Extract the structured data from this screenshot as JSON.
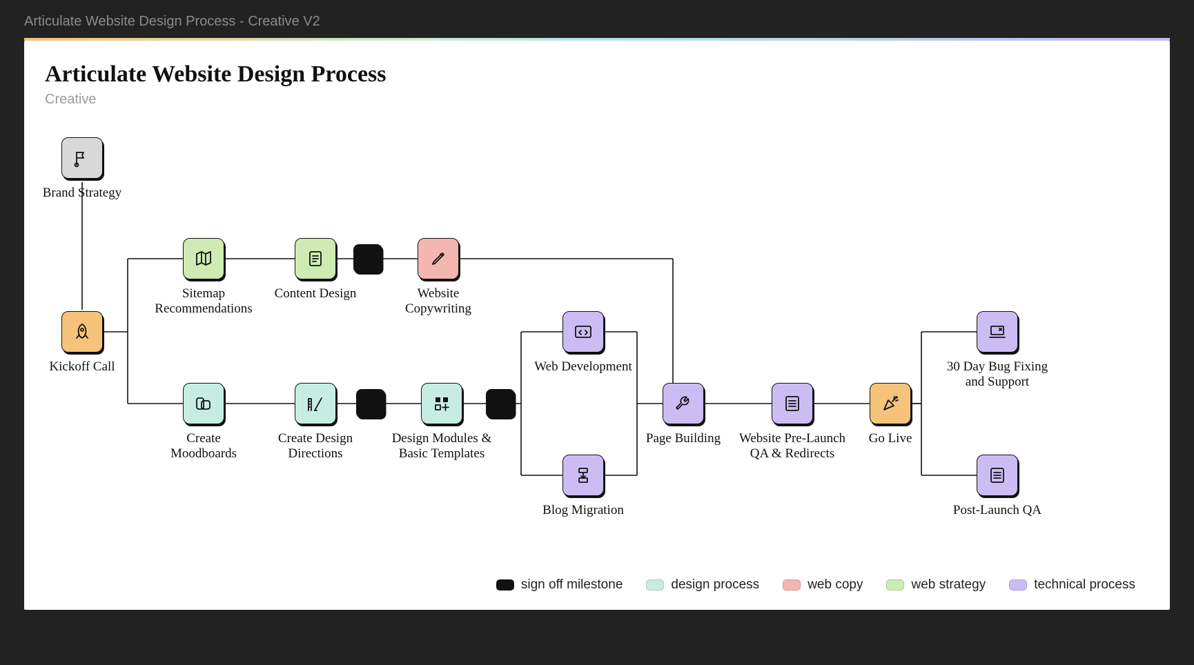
{
  "topbar": {
    "title": "Articulate Website Design Process - Creative V2"
  },
  "header": {
    "title": "Articulate Website Design Process",
    "subtitle": "Creative"
  },
  "colors": {
    "sign_off_milestone": "#111111",
    "design_process": "#c7ede3",
    "web_copy": "#f4b6b1",
    "web_strategy": "#cdebb2",
    "technical_process": "#cbbdf4",
    "kickoff": "#f6c37a",
    "brand": "#d9d9d9"
  },
  "legend": [
    {
      "label": "sign off milestone",
      "color_key": "sign_off_milestone"
    },
    {
      "label": "design process",
      "color_key": "design_process"
    },
    {
      "label": "web copy",
      "color_key": "web_copy"
    },
    {
      "label": "web strategy",
      "color_key": "web_strategy"
    },
    {
      "label": "technical process",
      "color_key": "technical_process"
    }
  ],
  "nodes": {
    "brand_strategy": {
      "label": "Brand Strategy",
      "category": "brand",
      "icon": "flag"
    },
    "kickoff_call": {
      "label": "Kickoff Call",
      "category": "kickoff",
      "icon": "rocket"
    },
    "sitemap": {
      "label": "Sitemap Recommendations",
      "category": "web_strategy",
      "icon": "map"
    },
    "content_design": {
      "label": "Content Design",
      "category": "web_strategy",
      "icon": "doc"
    },
    "signoff_top": {
      "label": "",
      "category": "sign_off_milestone",
      "icon": "check-doc",
      "small": true
    },
    "copywriting": {
      "label": "Website Copywriting",
      "category": "web_copy",
      "icon": "pencil"
    },
    "moodboards": {
      "label": "Create Moodboards",
      "category": "design_process",
      "icon": "swatch"
    },
    "directions": {
      "label": "Create Design Directions",
      "category": "design_process",
      "icon": "ruler"
    },
    "signoff_mid1": {
      "label": "",
      "category": "sign_off_milestone",
      "icon": "check-doc",
      "small": true
    },
    "modules": {
      "label": "Design Modules & Basic Templates",
      "category": "design_process",
      "icon": "grid"
    },
    "signoff_mid2": {
      "label": "",
      "category": "sign_off_milestone",
      "icon": "check-doc",
      "small": true
    },
    "web_dev": {
      "label": "Web Development",
      "category": "technical_process",
      "icon": "code"
    },
    "blog_migration": {
      "label": "Blog Migration",
      "category": "technical_process",
      "icon": "migrate"
    },
    "page_building": {
      "label": "Page Building",
      "category": "technical_process",
      "icon": "wrench"
    },
    "qa_redirects": {
      "label": "Website Pre-Launch QA & Redirects",
      "category": "technical_process",
      "icon": "list"
    },
    "go_live": {
      "label": "Go Live",
      "category": "kickoff",
      "icon": "party"
    },
    "bug_fixing": {
      "label": "30 Day Bug Fixing and Support",
      "category": "technical_process",
      "icon": "laptop"
    },
    "post_launch_qa": {
      "label": "Post-Launch QA",
      "category": "technical_process",
      "icon": "list"
    }
  }
}
